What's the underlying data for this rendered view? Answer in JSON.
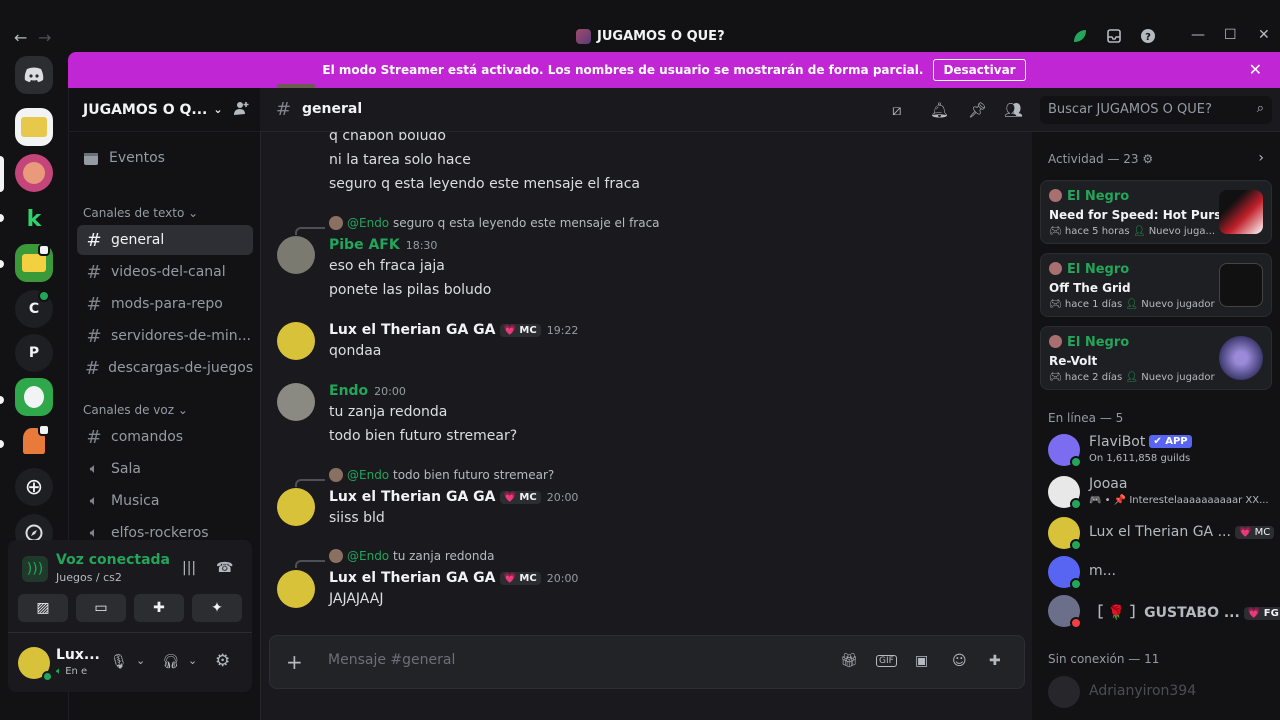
{
  "window": {
    "title": "JUGAMOS O QUE?",
    "back": "←",
    "forward": "→",
    "minimize": "—",
    "maximize": "☐",
    "close": "✕"
  },
  "banner": {
    "text": "El modo Streamer está activado. Los nombres de usuario se mostrarán de forma parcial.",
    "button": "Desactivar",
    "close": "✕"
  },
  "servers": [
    "C",
    "P"
  ],
  "guild": {
    "name": "JUGAMOS O Q...",
    "chevron": "⌄"
  },
  "sidebar": {
    "events": "Eventos",
    "text_category": "Canales de texto",
    "voice_category": "Canales de voz",
    "text_channels": [
      "general",
      "videos-del-canal",
      "mods-para-repo",
      "servidores-de-min...",
      "descargas-de-juegos"
    ],
    "voice_channels": [
      "comandos",
      "Sala",
      "Musica",
      "elfos-rockeros"
    ]
  },
  "voice": {
    "title": "Voz conectada",
    "channel": "Juegos / cs2"
  },
  "user": {
    "name": "Lux...",
    "status": "En e"
  },
  "chat": {
    "channel": "general",
    "search_placeholder": "Buscar JUGAMOS O QUE?",
    "composer_placeholder": "Mensaje #general",
    "messages": [
      {
        "lines": [
          "q chabon boludo",
          "ni la tarea solo hace",
          "seguro q esta leyendo este mensaje el fraca"
        ]
      },
      {
        "reply_name": "@Endo",
        "reply_text": "seguro q esta leyendo este mensaje el fraca",
        "author": "Pibe AFK",
        "time": "18:30",
        "lines": [
          "eso eh fraca jaja",
          "ponete las pilas boludo"
        ]
      },
      {
        "author": "Lux el Therian GA GA",
        "tag": "💗 MC",
        "time": "19:22",
        "lines": [
          "qondaa"
        ]
      },
      {
        "author": "Endo",
        "time": "20:00",
        "lines": [
          "tu zanja redonda",
          "todo bien futuro stremear?"
        ]
      },
      {
        "reply_name": "@Endo",
        "reply_text": "todo bien futuro stremear?",
        "author": "Lux el Therian GA GA",
        "tag": "💗 MC",
        "time": "20:00",
        "lines": [
          "siiss bld"
        ]
      },
      {
        "reply_name": "@Endo",
        "reply_text": "tu zanja redonda",
        "author": "Lux el Therian GA GA",
        "tag": "💗 MC",
        "time": "20:00",
        "lines": [
          "JAJAJAAJ"
        ]
      }
    ]
  },
  "activity": {
    "header": "Actividad — 23",
    "cards": [
      {
        "user": "El Negro",
        "game": "Need for Speed: Hot Pursuit",
        "when": "hace 5 horas",
        "note": "Nuevo juga..."
      },
      {
        "user": "El Negro",
        "game": "Off The Grid",
        "when": "hace 1 días",
        "note": "Nuevo jugador"
      },
      {
        "user": "El Negro",
        "game": "Re-Volt",
        "when": "hace 2 días",
        "note": "Nuevo jugador"
      }
    ]
  },
  "members": {
    "online_header": "En línea — 5",
    "offline_header": "Sin conexión — 11",
    "online": [
      {
        "name": "FlaviBot",
        "badge": "✔ APP",
        "sub": "On 1,611,858 guilds",
        "color": "#7c6cf0"
      },
      {
        "name": "Jooaa",
        "sub": "🎮 • 📌 Interestelaaaaaaaaaar XX...",
        "color": "#e8e8e8"
      },
      {
        "name": "Lux el Therian GA ...",
        "tag": "💗 MC",
        "color": "#d8c23a"
      },
      {
        "name": "m...",
        "color": "#5865f2"
      },
      {
        "name": "［ 🌹 ］GUSTABO ...",
        "tag": "💗 FG",
        "color": "#6b6f8a"
      }
    ],
    "offline": [
      {
        "name": "Adrianyiron394"
      }
    ]
  }
}
